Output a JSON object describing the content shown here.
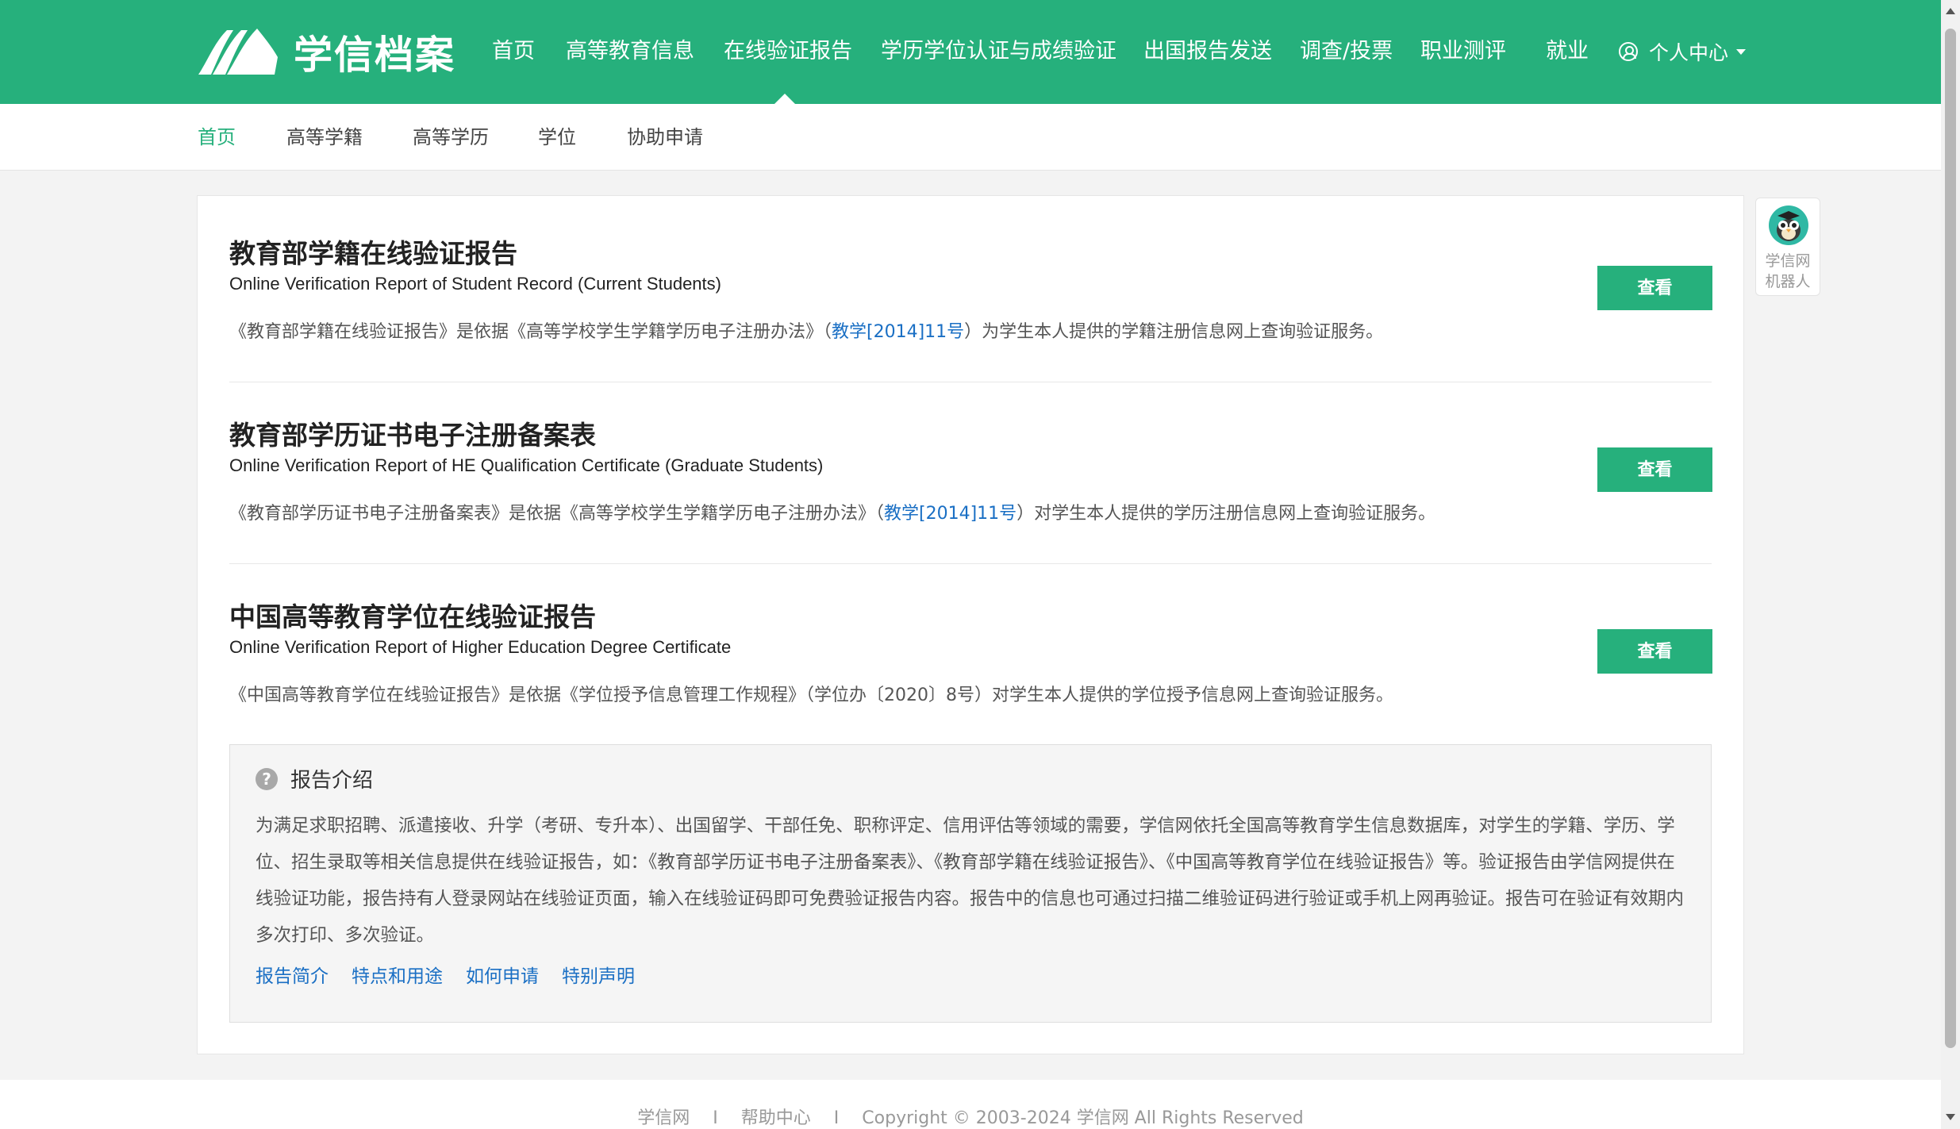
{
  "brand": {
    "name": "学信档案",
    "accent": "#26b07c"
  },
  "nav": {
    "items": [
      "首页",
      "高等教育信息",
      "在线验证报告",
      "学历学位认证与成绩验证",
      "出国报告发送",
      "调查/投票",
      "职业测评",
      "就业"
    ],
    "active": "在线验证报告",
    "user": "个人中心"
  },
  "subnav": {
    "items": [
      "首页",
      "高等学籍",
      "高等学历",
      "学位",
      "协助申请"
    ],
    "active": "首页"
  },
  "reports": [
    {
      "title": "教育部学籍在线验证报告",
      "subtitle": "Online Verification Report of Student Record (Current Students)",
      "desc_pre": "《教育部学籍在线验证报告》是依据《高等学校学生学籍学历电子注册办法》（",
      "desc_link": "教学[2014]11号",
      "desc_post": "）为学生本人提供的学籍注册信息网上查询验证服务。",
      "button": "查看"
    },
    {
      "title": "教育部学历证书电子注册备案表",
      "subtitle": "Online Verification Report of HE Qualification Certificate (Graduate Students)",
      "desc_pre": "《教育部学历证书电子注册备案表》是依据《高等学校学生学籍学历电子注册办法》（",
      "desc_link": "教学[2014]11号",
      "desc_post": "）对学生本人提供的学历注册信息网上查询验证服务。",
      "button": "查看"
    },
    {
      "title": "中国高等教育学位在线验证报告",
      "subtitle": "Online Verification Report of Higher Education Degree Certificate",
      "desc_pre": "《中国高等教育学位在线验证报告》是依据《学位授予信息管理工作规程》（学位办〔2020〕8号）对学生本人提供的学位授予信息网上查询验证服务。",
      "desc_link": "",
      "desc_post": "",
      "button": "查看"
    }
  ],
  "intro": {
    "title": "报告介绍",
    "icon": "question-icon",
    "body": "为满足求职招聘、派遣接收、升学（考研、专升本）、出国留学、干部任免、职称评定、信用评估等领域的需要，学信网依托全国高等教育学生信息数据库，对学生的学籍、学历、学位、招生录取等相关信息提供在线验证报告，如：《教育部学历证书电子注册备案表》、《教育部学籍在线验证报告》、《中国高等教育学位在线验证报告》等。验证报告由学信网提供在线验证功能，报告持有人登录网站在线验证页面，输入在线验证码即可免费验证报告内容。报告中的信息也可通过扫描二维验证码进行验证或手机上网再验证。报告可在验证有效期内多次打印、多次验证。",
    "links": [
      "报告简介",
      "特点和用途",
      "如何申请",
      "特别声明"
    ]
  },
  "robot": {
    "line1": "学信网",
    "line2": "机器人"
  },
  "footer": {
    "site": "学信网",
    "help": "帮助中心",
    "copyright": "Copyright © 2003-2024 学信网 All Rights Reserved",
    "separator": "I"
  }
}
